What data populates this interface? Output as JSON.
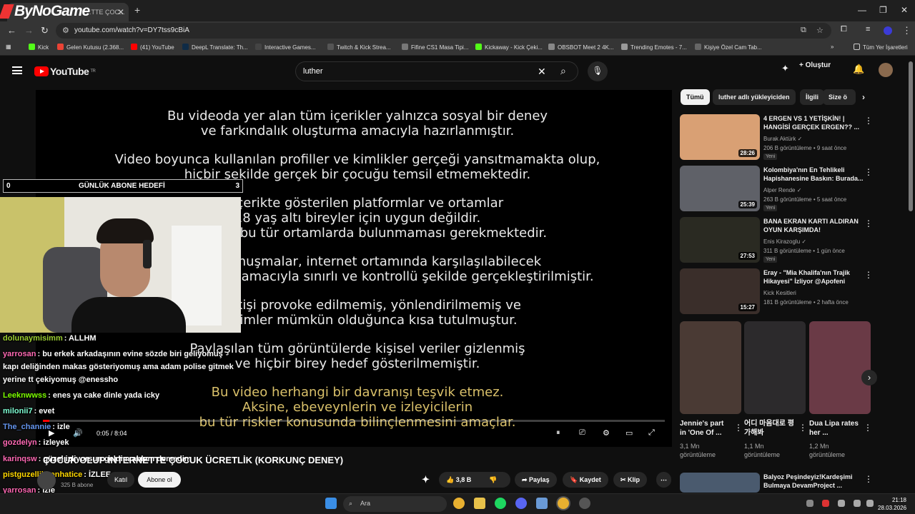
{
  "browser": {
    "tab_title": "...TTE ÇOC...",
    "overlay_logo": "ByNoGame",
    "url": "youtube.com/watch?v=DY7tss9cBiA",
    "bookmarks": [
      "Kick",
      "Gelen Kutusu (2.368...",
      "(41) YouTube",
      "DeepL Translate: Th...",
      "Interactive Games...",
      "Twitch & Kick Strea...",
      "Fifine CS1 Masa Tipi...",
      "Kickaway - Kick Çeki...",
      "OBSBOT Meet 2 4K...",
      "Trending Emotes - 7...",
      "Kişiye Özel Cam Tab..."
    ],
    "bookmarks_all": "Tüm Yer İşaretleri"
  },
  "header": {
    "logo": "YouTube",
    "logo_sup": "TR",
    "search_value": "luther",
    "create_label": "Oluştur"
  },
  "video": {
    "lines": [
      "Bu videoda yer alan tüm içerikler yalnızca sosyal bir deney",
      "ve farkındalık oluşturma amacıyla hazırlanmıştır.",
      "Video boyunca kullanılan profiller ve kimlikler gerçeği yansıtmamakta olup,",
      "hiçbir şekilde gerçek bir çocuğu temsil etmemektedir.",
      "Bu içerikte gösterilen platformlar ve ortamlar",
      "18 yaş altı bireyler için uygun değildir.",
      "Çocukların bu tür ortamlarda bulunmaması gerekmektedir.",
      "Yapılan konuşmalar, internet ortamında karşılaşılabilecek",
      "riskleri göstermek amacıyla sınırlı ve kontrollü şekilde gerçekleştirilmiştir.",
      "Hiçbir kişi provoke edilmemiş, yönlendirilmemiş ve",
      "etkileşimler mümkün olduğunca kısa tutulmuştur.",
      "Paylaşılan tüm görüntülerde kişisel veriler gizlenmiş",
      "ve hiçbir birey hedef gösterilmemiştir."
    ],
    "gold_lines": [
      "Bu video herhangi bir davranışı teşvik etmez.",
      "Aksine, ebeveynlerin ve izleyicilerin",
      "bu tür riskler konusunda bilinçlenmesini amaçlar."
    ],
    "time": "0:05 / 8:04",
    "progress": 0.01,
    "title": "ÇOCUK OLUP İNTERNETTE ÇOCUK ÜCRETLİK (KORKUNÇ DENEY)",
    "subs": "325 B abone",
    "join": "Katıl",
    "subscribe": "Abone ol",
    "likes": "3,8 B",
    "share": "Paylaş",
    "save": "Kaydet",
    "clip": "Klip"
  },
  "overlay": {
    "goal": {
      "left": "0",
      "label": "GÜNLÜK ABONE HEDEFİ",
      "right": "3"
    },
    "chat": [
      {
        "user": "dolunaymisimm",
        "text": ": ALLHM",
        "color": "#9acd32"
      },
      {
        "user": "yarrosan",
        "text": ": bu erkek arkadaşının evine sözde biri geliyomuş",
        "color": "#ff69b4"
      },
      {
        "user": "",
        "text": "kapı deliğinden makas gösteriyomuş ama adam polise gitmek",
        "color": "#fff"
      },
      {
        "user": "",
        "text": "yerine tt çekiyomuş @enessho",
        "color": "#fff"
      },
      {
        "user": "Leeknwwss",
        "text": ": enes ya cake dinle yada icky",
        "color": "#7cfc00"
      },
      {
        "user": "milonii7",
        "text": ": evet",
        "color": "#7fffd4"
      },
      {
        "user": "The_channie",
        "text": ": izle",
        "color": "#6495ed"
      },
      {
        "user": "gozdelyn",
        "text": ": izleyek",
        "color": "#ff69b4"
      },
      {
        "user": "karinqsw",
        "text": ": güzel izliyorsun geldim ablam demedim",
        "color": "#ff69b4"
      },
      {
        "user": "pistguzellikbenhatice",
        "text": ": İZLEE",
        "color": "#ffd700"
      },
      {
        "user": "yarrosan",
        "text": ": izle",
        "color": "#ff69b4"
      }
    ]
  },
  "sidebar": {
    "chips": [
      "Tümü",
      "luther adlı yükleyiciden",
      "İlgili",
      "Size ö"
    ],
    "recs": [
      {
        "title": "4 ERGEN VS 1 YETİŞKİN! | HANGİSİ GERÇEK ERGEN?? ...",
        "channel": "Burak Aktürk ✓",
        "meta": "206 B görüntüleme • 9 saat önce",
        "badge": "Yeni",
        "dur": "28:26",
        "color": "#d9a074"
      },
      {
        "title": "Kolombiya'nın En Tehlikeli Hapishanesine Baskın: Burada...",
        "channel": "Alper Rende ✓",
        "meta": "263 B görüntüleme • 5 saat önce",
        "badge": "Yeni",
        "dur": "25:39",
        "color": "#5f6168"
      },
      {
        "title": "BANA EKRAN KARTI ALDIRAN OYUN KARŞIMDA!",
        "channel": "Enis Kirazoglu ✓",
        "meta": "311 B görüntüleme • 1 gün önce",
        "badge": "Yeni",
        "dur": "27:53",
        "color": "#2a2a22"
      },
      {
        "title": "Eray - \"Mia Khalifa'nın Trajik Hikayesi\" İzliyor @Apofeni",
        "channel": "Kick Kesitleri",
        "meta": "181 B görüntüleme • 2 hafta önce",
        "badge": "",
        "dur": "15:27",
        "color": "#3a2e2a"
      }
    ],
    "shorts": [
      {
        "title": "Jennie's part in 'One Of ...",
        "views": "3,1 Mn görüntüleme",
        "color": "#4a3a34"
      },
      {
        "title": "어디 마음대로 평가해봐",
        "views": "1,1 Mn görüntüleme",
        "color": "#2c2a2c"
      },
      {
        "title": "Dua Lipa rates her ...",
        "views": "1,2 Mn görüntüleme",
        "color": "#6a3a46"
      }
    ],
    "last_rec": "Balyoz Peşindeyiz!Kardeşimi Bulmaya DevamProject ..."
  },
  "taskbar": {
    "search": "Ara",
    "time": "21:18",
    "date": "28.03.2026"
  }
}
